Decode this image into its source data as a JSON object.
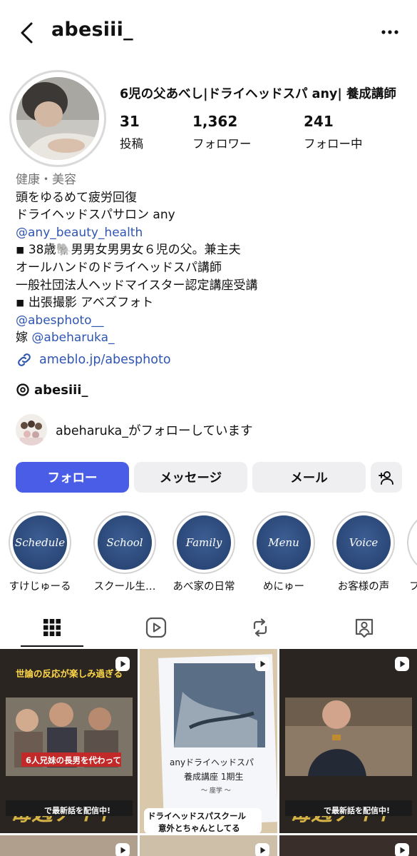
{
  "header": {
    "username": "abesiii_"
  },
  "profile": {
    "display_name": "6児の父あべし|ドライヘッドスパ any| 養成講師",
    "stats": [
      {
        "value": "31",
        "label": "投稿"
      },
      {
        "value": "1,362",
        "label": "フォロワー"
      },
      {
        "value": "241",
        "label": "フォロー中"
      }
    ],
    "category": "健康・美容",
    "bio_line1": "頭をゆるめて疲労回復",
    "bio_line2": "ドライヘッドスパサロン any",
    "bio_mention1": "@any_beauty_health",
    "bio_line4": "◾︎ 38歳🐘男男女男男女６児の父。兼主夫",
    "bio_line5": "オールハンドのドライヘッドスパ講師",
    "bio_line6": "一般社団法人ヘッドマイスター認定講座受講",
    "bio_line7": "◾︎ 出張撮影 アベズフォト",
    "bio_mention2": "@abesphoto__",
    "bio_line9_prefix": "嫁 ",
    "bio_mention3": "@abeharuka_",
    "link": "ameblo.jp/abesphoto",
    "threads": "abesiii_",
    "followed_by": "abeharuka_がフォローしています"
  },
  "actions": {
    "follow": "フォロー",
    "message": "メッセージ",
    "mail": "メール"
  },
  "highlights": [
    {
      "cover_text": "Schedule",
      "label": "すけじゅーる"
    },
    {
      "cover_text": "School",
      "label": "スクール生…"
    },
    {
      "cover_text": "Family",
      "label": "あべ家の日常"
    },
    {
      "cover_text": "Menu",
      "label": "めにゅー"
    },
    {
      "cover_text": "Voice",
      "label": "お客様の声"
    },
    {
      "cover_text": "",
      "label": "フ"
    }
  ],
  "posts": {
    "post1_top": "世論の反応が楽しみ過ぎる",
    "post1_banner": "6人兄妹の長男を代わって",
    "post1_bottom": "で最新話を配信中!",
    "post2_title": "anyドライヘッドスパ",
    "post2_sub": "養成講座 1期生",
    "post2_small": "〜 座学 〜",
    "post2_caption1": "ドライヘッドスパスクール",
    "post2_caption2": "意外とちゃんとしてる",
    "post3_bottom": "で最新話を配信中!"
  },
  "colors": {
    "accent": "#4a5de6",
    "link": "#2f55b3"
  }
}
